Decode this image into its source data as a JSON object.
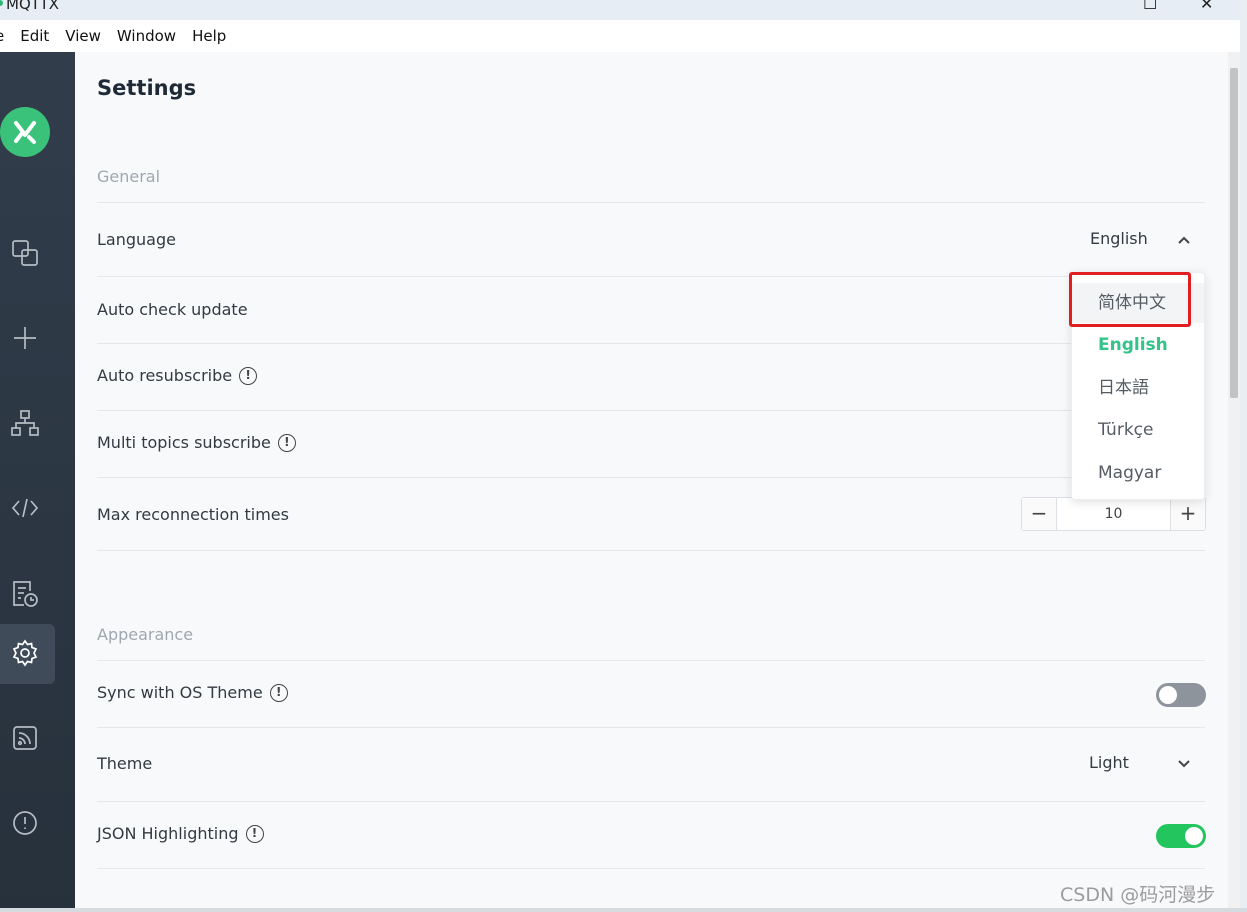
{
  "window": {
    "title": "MQTTX",
    "maximize_glyph": "☐",
    "close_glyph": "✕"
  },
  "menu": [
    "e",
    "Edit",
    "View",
    "Window",
    "Help"
  ],
  "sidebar": {
    "items": [
      {
        "icon": "connections-icon"
      },
      {
        "icon": "plus-icon"
      },
      {
        "icon": "topology-icon"
      },
      {
        "icon": "script-icon"
      },
      {
        "icon": "log-icon"
      },
      {
        "icon": "gear-icon",
        "active": true
      },
      {
        "icon": "feed-icon"
      },
      {
        "icon": "about-icon"
      }
    ]
  },
  "page": {
    "title": "Settings"
  },
  "general": {
    "title": "General",
    "language_label": "Language",
    "language_value": "English",
    "auto_check_update_label": "Auto check update",
    "auto_resubscribe_label": "Auto resubscribe",
    "multi_topics_label": "Multi topics subscribe",
    "max_reconnect_label": "Max reconnection times",
    "max_reconnect_value": "10",
    "minus": "−",
    "plus": "+"
  },
  "appearance": {
    "title": "Appearance",
    "sync_os_label": "Sync with OS Theme",
    "sync_os_on": false,
    "theme_label": "Theme",
    "theme_value": "Light",
    "json_highlight_label": "JSON Highlighting",
    "json_highlight_on": true
  },
  "language_options": [
    {
      "label": "简体中文",
      "hover": true
    },
    {
      "label": "English",
      "selected": true
    },
    {
      "label": "日本語"
    },
    {
      "label": "Türkçe"
    },
    {
      "label": "Magyar"
    }
  ],
  "info_glyph": "!",
  "watermark": "CSDN @码河漫步"
}
